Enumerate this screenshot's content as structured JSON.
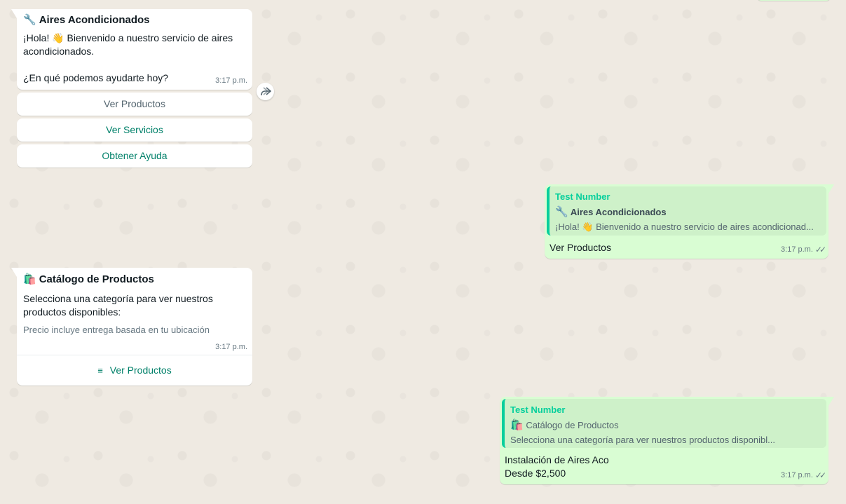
{
  "colors": {
    "background": "#efeae2",
    "incoming": "#ffffff",
    "outgoing": "#d9fdd3",
    "quote_accent": "#06cf9c",
    "button_text": "#008069"
  },
  "msg1": {
    "icon": "wrench-icon",
    "title_emoji": "🔧",
    "title": "Aires Acondicionados",
    "line1": "¡Hola! 👋 Bienvenido a nuestro servicio de aires",
    "line2": "acondicionados.",
    "line3": "¿En qué podemos ayudarte hoy?",
    "time": "3:17 p.m.",
    "buttons": [
      "Ver Productos",
      "Ver Servicios",
      "Obtener Ayuda"
    ]
  },
  "reply1": {
    "author": "Test Number",
    "quote_emoji": "🔧",
    "quote_title": "Aires Acondicionados",
    "quote_text": "¡Hola! 👋 Bienvenido a nuestro servicio de aires acondicionad...",
    "text": "Ver Productos",
    "time": "3:17 p.m.",
    "ticks": "✓✓"
  },
  "msg2": {
    "title_emoji": "🛍️",
    "title": "Catálogo de Productos",
    "line1": "Selecciona una categoría para ver nuestros",
    "line2": "productos disponibles:",
    "footer": "Precio incluye entrega basada en tu ubicación",
    "time": "3:17 p.m.",
    "list_icon": "≡",
    "list_button": "Ver Productos"
  },
  "reply2": {
    "author": "Test Number",
    "quote_emoji": "🛍️",
    "quote_title": "Catálogo de Productos",
    "quote_text": "Selecciona una categoría para ver nuestros productos disponibl...",
    "text_line1": "Instalación de Aires Aco",
    "text_line2": "Desde $2,500",
    "time": "3:17 p.m.",
    "ticks": "✓✓"
  }
}
